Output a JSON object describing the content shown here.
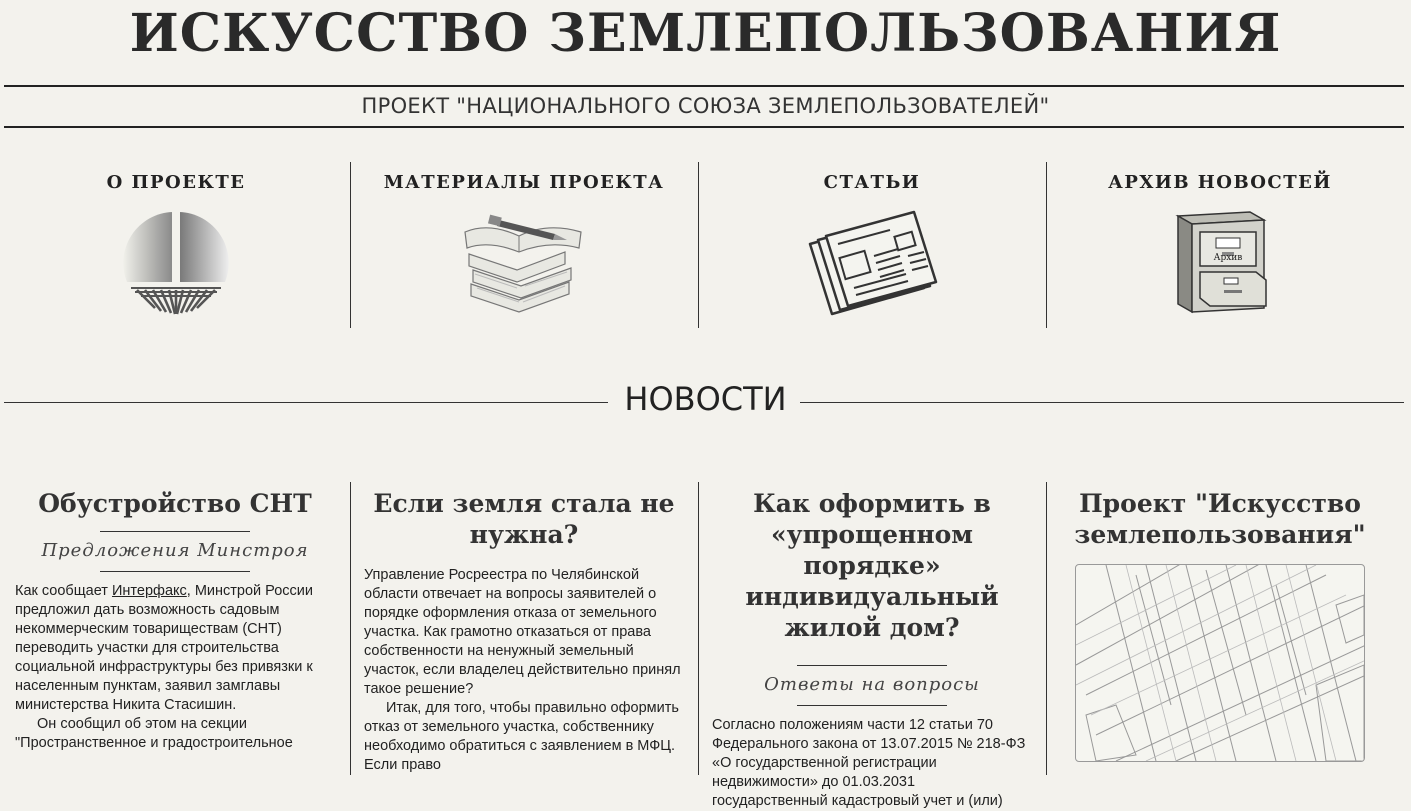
{
  "site": {
    "title": "ИСКУССТВО ЗЕМЛЕПОЛЬЗОВАНИЯ",
    "subtitle": "ПРОЕКТ \"НАЦИОНАЛЬНОГО СОЮЗА ЗЕМЛЕПОЛЬЗОВАТЕЛЕЙ\""
  },
  "nav": [
    {
      "label": "О ПРОЕКТЕ",
      "icon": "pie-logo-icon"
    },
    {
      "label": "МАТЕРИАЛЫ ПРОЕКТА",
      "icon": "books-pen-icon"
    },
    {
      "label": "СТАТЬИ",
      "icon": "newspaper-icon"
    },
    {
      "label": "АРХИВ НОВОСТЕЙ",
      "icon": "archive-cabinet-icon",
      "icon_text": "Архив"
    }
  ],
  "news": {
    "heading": "НОВОСТИ",
    "articles": [
      {
        "title": "Обустройство СНТ",
        "category": "Предложения Минстроя",
        "p1_before": "Как сообщает ",
        "p1_link": "Интерфакс",
        "p1_after": ", Минстрой России предложил дать возможность садовым некоммерческим товариществам (СНТ) переводить участки для строительства социальной инфраструктуры без привязки к населенным пунктам, заявил замглавы министерства Никита Стасишин.",
        "p2": "Он сообщил об этом на секции \"Пространственное и градостроительное"
      },
      {
        "title": "Если земля стала не нужна?",
        "p1": "Управление Росреестра по Челябинской области отвечает на вопросы заявителей о порядке оформления отказа от земельного участка. Как грамотно отказаться от права собственности на ненужный земельный участок, если владелец действительно принял такое решение?",
        "p2": "Итак, для того, чтобы правильно оформить отказ от земельного участка, собственнику необходимо обратиться с заявлением в МФЦ. Если право"
      },
      {
        "title": "Как оформить в «упрощенном порядке» индивидуальный жилой дом?",
        "category": "Ответы на вопросы",
        "p1": "Согласно положениям части 12 статьи 70 Федерального закона от 13.07.2015 № 218-ФЗ «О государственной регистрации недвижимости» до 01.03.2031 государственный кадастровый учет и (или)"
      },
      {
        "title": "Проект \"Искусство землепользования\"",
        "image": "cadastral-map"
      }
    ]
  }
}
